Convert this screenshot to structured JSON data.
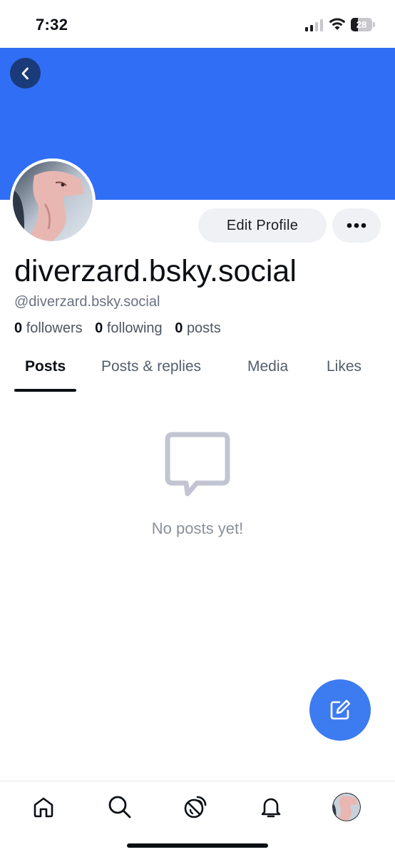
{
  "status_bar": {
    "time": "7:32",
    "battery_level": "28"
  },
  "profile": {
    "display_name": "diverzard.bsky.social",
    "handle": "@diverzard.bsky.social",
    "stats": {
      "followers_count": "0",
      "followers_label": "followers",
      "following_count": "0",
      "following_label": "following",
      "posts_count": "0",
      "posts_label": "posts"
    },
    "edit_profile_label": "Edit Profile"
  },
  "tabs": [
    {
      "label": "Posts",
      "active": true
    },
    {
      "label": "Posts & replies",
      "active": false
    },
    {
      "label": "Media",
      "active": false
    },
    {
      "label": "Likes",
      "active": false
    }
  ],
  "empty_state": {
    "message": "No posts yet!"
  },
  "colors": {
    "banner": "#306ef5",
    "compose_button": "#3d7bf1",
    "active_tab_indicator": "#0b0f14"
  },
  "icons": {
    "back": "chevron-left-icon",
    "more": "more-dots-icon",
    "empty": "message-bubble-icon",
    "compose": "compose-icon",
    "nav": [
      "home-icon",
      "search-icon",
      "feeds-icon",
      "notifications-icon",
      "profile-avatar"
    ]
  }
}
